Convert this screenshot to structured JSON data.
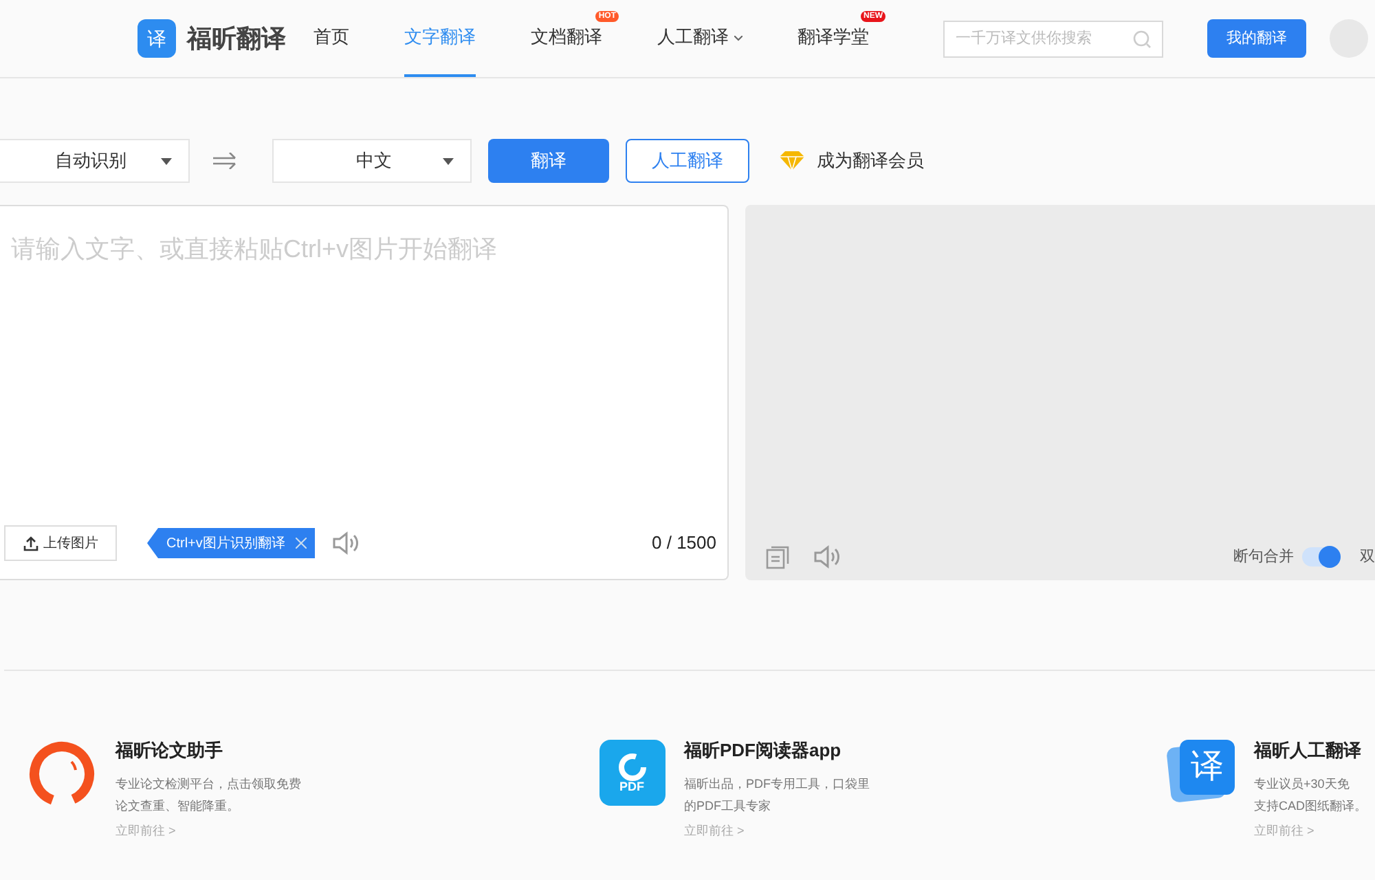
{
  "header": {
    "logo_glyph": "译",
    "brand": "福昕翻译",
    "nav": [
      {
        "label": "首页",
        "selected": false
      },
      {
        "label": "文字翻译",
        "selected": true
      },
      {
        "label": "文档翻译",
        "selected": false,
        "badge": {
          "text": "HOT",
          "color": "#ff5a2a"
        }
      },
      {
        "label": "人工翻译",
        "selected": false,
        "dropdown": true
      },
      {
        "label": "翻译学堂",
        "selected": false,
        "badge": {
          "text": "NEW",
          "color": "#e8151b"
        }
      }
    ],
    "search": {
      "placeholder": "一千万译文供你搜索"
    },
    "my_button": "我的翻译"
  },
  "toolbar": {
    "source": "自动识别",
    "target": "中文",
    "translate": "翻译",
    "human": "人工翻译",
    "member": "成为翻译会员"
  },
  "input": {
    "placeholder": "请输入文字、或直接粘贴Ctrl+v图片开始翻译",
    "upload": "上传图片",
    "tip": "Ctrl+v图片识别翻译",
    "counter": "0 / 1500"
  },
  "output": {
    "merge_label": "断句合并",
    "merge_on": true,
    "bilingual": "双"
  },
  "cards": [
    {
      "kind": "ring",
      "title": "福昕论文助手",
      "desc": "专业论文检测平台，点击领取免费论文查重、智能降重。",
      "link": "立即前往 >"
    },
    {
      "kind": "pdf",
      "glyph": "PDF",
      "title": "福昕PDF阅读器app",
      "desc": "福昕出品，PDF专用工具，口袋里的PDF工具专家",
      "link": "立即前往 >"
    },
    {
      "kind": "bubble",
      "glyph": "译",
      "title": "福昕人工翻译",
      "desc": "专业议员+30天免",
      "desc2": "支持CAD图纸翻译。",
      "link": "立即前往 >"
    }
  ]
}
